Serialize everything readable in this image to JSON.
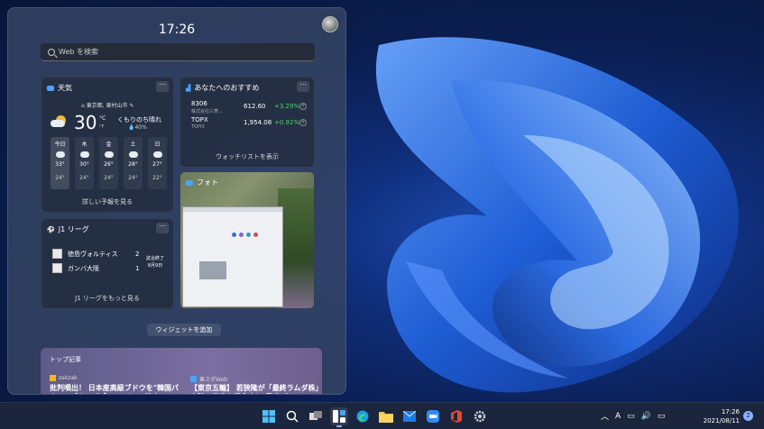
{
  "panel": {
    "clock": "17:26",
    "search_placeholder": "Web を検索"
  },
  "weather": {
    "title": "天気",
    "location": "東京都, 東村山市",
    "temp": "30",
    "unit_c": "°C",
    "unit_f": "°F",
    "condition": "くもりのち晴れ",
    "rain": "40%",
    "days": [
      {
        "label": "今日",
        "hi": "33°",
        "lo": "24°"
      },
      {
        "label": "木",
        "hi": "30°",
        "lo": "24°"
      },
      {
        "label": "金",
        "hi": "26°",
        "lo": "24°"
      },
      {
        "label": "土",
        "hi": "28°",
        "lo": "24°"
      },
      {
        "label": "日",
        "hi": "27°",
        "lo": "22°"
      }
    ],
    "link": "詳しい予報を見る"
  },
  "stocks": {
    "title": "あなたへのおすすめ",
    "items": [
      {
        "symbol": "8306",
        "name": "株式会社三菱...",
        "price": "612.60",
        "change": "+3.29%"
      },
      {
        "symbol": "TOPX",
        "name": "TOPIX",
        "price": "1,954.08",
        "change": "+0.92%"
      }
    ],
    "link": "ウォッチリストを表示"
  },
  "photos": {
    "title": "フォト"
  },
  "jleague": {
    "title": "J1 リーグ",
    "teams": [
      {
        "name": "徳島ヴォルティス",
        "score": "2"
      },
      {
        "name": "ガンバ大阪",
        "score": "1"
      }
    ],
    "status_line1": "試合終了",
    "status_line2": "8月9日",
    "link": "J1 リーグをもっと見る"
  },
  "add_widget": "ウィジェットを追加",
  "stories": {
    "title": "トップ記事",
    "items": [
      {
        "source": "zakzak",
        "headline": "批判噴出！ 日本産高級ブドウを\"韓国パクリ\" ブテレビ「イット！」 韓自"
      },
      {
        "source": "東スポWeb",
        "headline": "【東京五輪】 若狭隆が「最終ラムダ株」上陸の東京を懸念中に\"警察 表メ"
      }
    ]
  },
  "taskbar": {
    "ime": "A",
    "time": "17:26",
    "date": "2021/08/11",
    "notifications": "2"
  }
}
